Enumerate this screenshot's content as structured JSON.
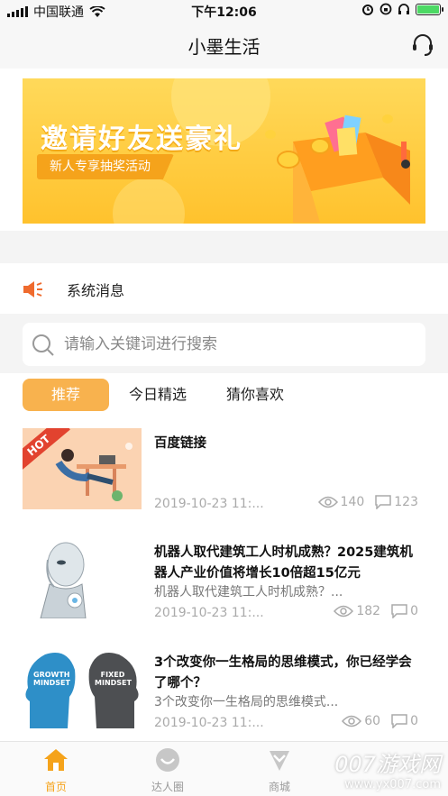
{
  "status_bar": {
    "carrier": "中国联通",
    "time": "下午12:06"
  },
  "header": {
    "title": "小墨生活"
  },
  "banner": {
    "title": "邀请好友送豪礼",
    "subtitle": "新人专享抽奖活动"
  },
  "system_message": {
    "label": "系统消息"
  },
  "search": {
    "placeholder": "请输入关键词进行搜索"
  },
  "tabs": [
    {
      "label": "推荐",
      "active": true
    },
    {
      "label": "今日精选",
      "active": false
    },
    {
      "label": "猜你喜欢",
      "active": false
    }
  ],
  "articles": [
    {
      "badge": "HOT",
      "title": "百度链接",
      "desc": "",
      "date": "2019-10-23 11:...",
      "views": "140",
      "comments": "123"
    },
    {
      "title": "机器人取代建筑工人时机成熟？2025建筑机器人产业价值将增长10倍超15亿元",
      "desc": "机器人取代建筑工人时机成熟？...",
      "date": "2019-10-23 11:...",
      "views": "182",
      "comments": "0"
    },
    {
      "title": "3个改变你一生格局的思维模式，你已经学会了哪个？",
      "desc": "3个改变你一生格局的思维模式...",
      "date": "2019-10-23 11:...",
      "views": "60",
      "comments": "0",
      "thumb_text": {
        "growth": "GROWTH MINDSET",
        "fixed": "FIXED MINDSET"
      }
    }
  ],
  "tabbar": [
    {
      "label": "首页",
      "icon": "home-icon",
      "active": true
    },
    {
      "label": "达人圈",
      "icon": "circle-icon",
      "active": false
    },
    {
      "label": "商城",
      "icon": "mall-icon",
      "active": false
    }
  ],
  "watermark": {
    "main": "007游戏网",
    "sub": "www.yx007.com"
  },
  "colors": {
    "accent": "#f8b24e",
    "banner_bg": "#ffc22d",
    "speaker": "#ef6b2e"
  }
}
